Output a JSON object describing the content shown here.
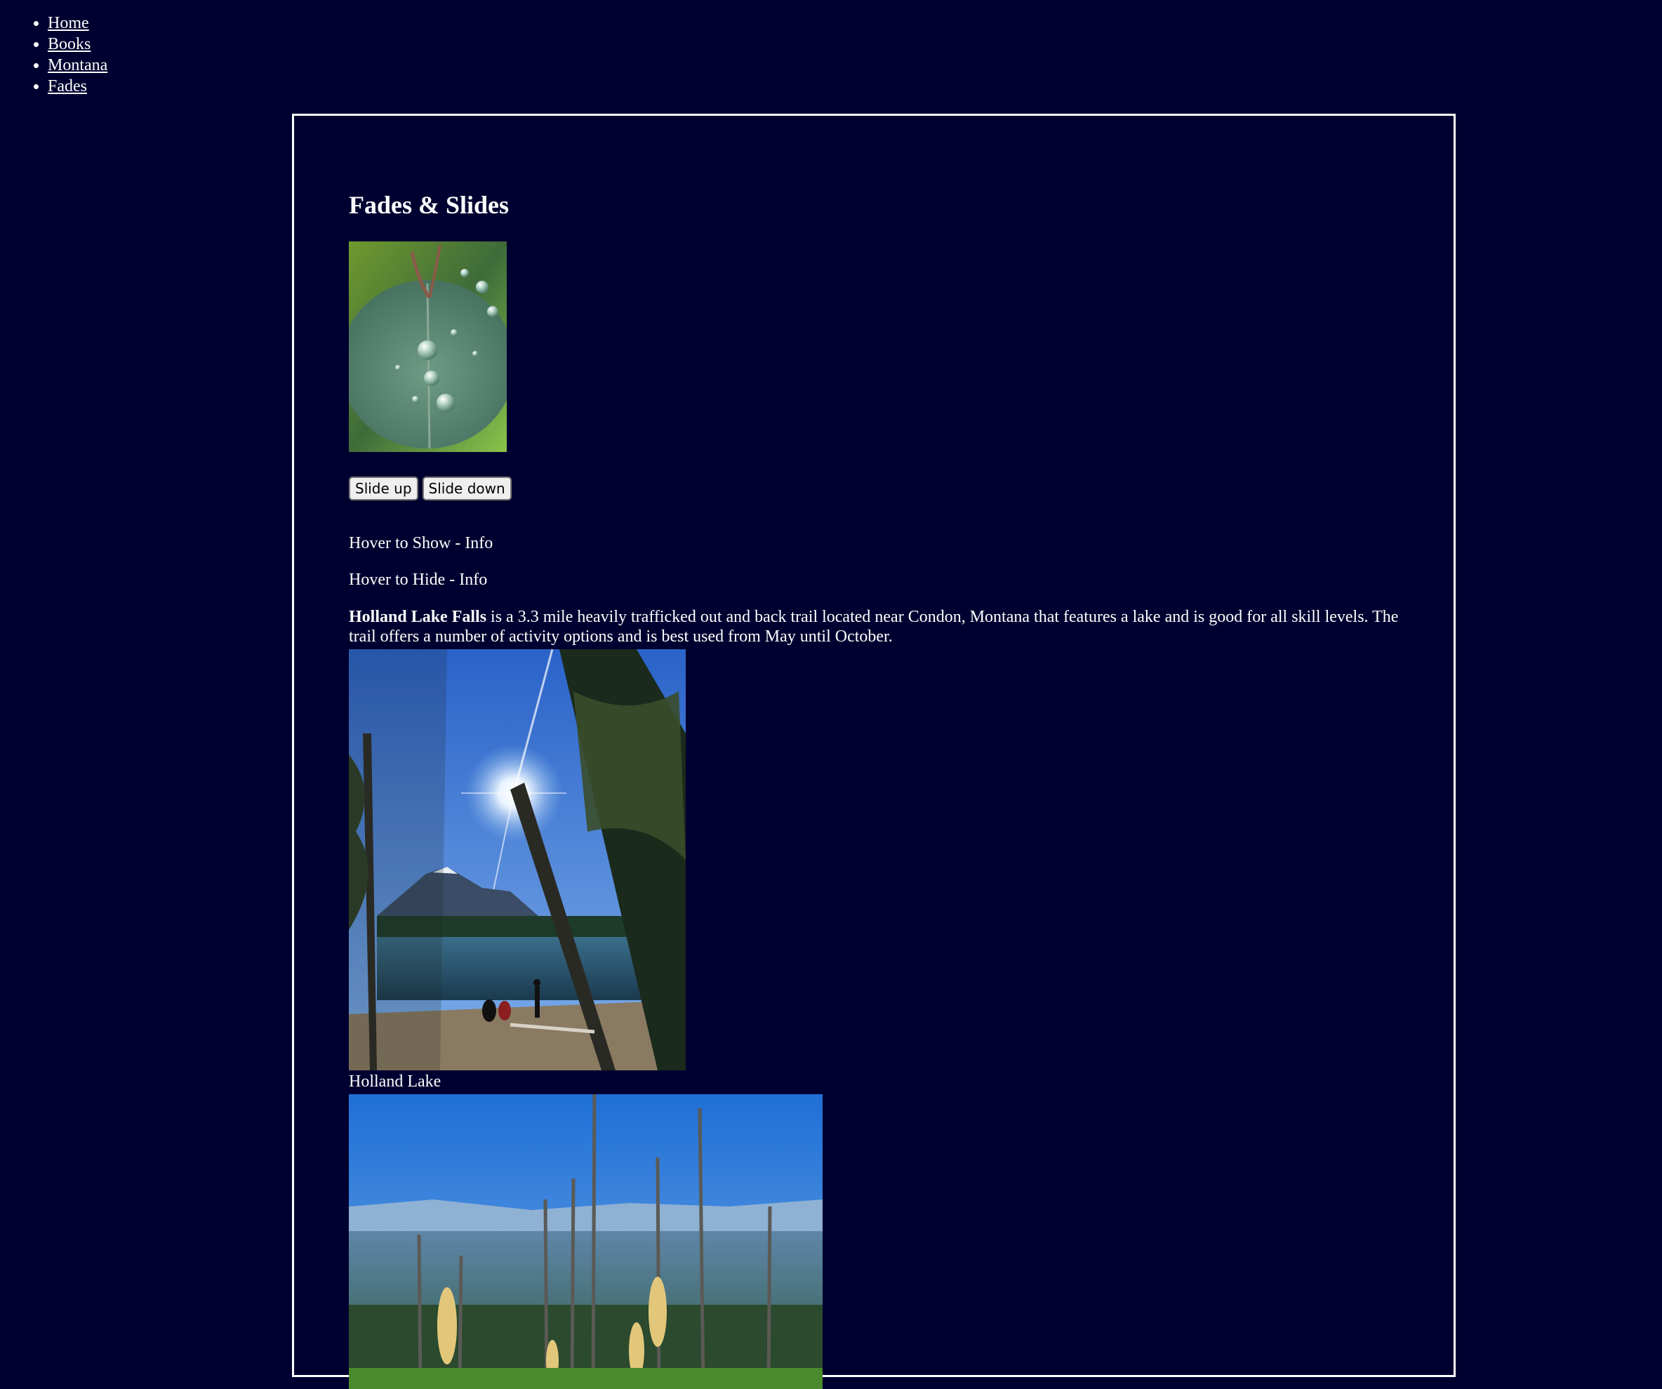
{
  "nav": {
    "items": [
      {
        "label": "Home"
      },
      {
        "label": "Books"
      },
      {
        "label": "Montana"
      },
      {
        "label": "Fades"
      }
    ]
  },
  "main": {
    "title": "Fades & Slides",
    "buttons": {
      "slide_up": "Slide up",
      "slide_down": "Slide down"
    },
    "hover_show": "Hover to Show - Info",
    "hover_hide": "Hover to Hide - Info",
    "description": {
      "bold": "Holland Lake Falls",
      "text": " is a 3.3 mile heavily trafficked out and back trail located near Condon, Montana that features a lake and is good for all skill levels. The trail offers a number of activity options and is best used from May until October."
    },
    "caption": "Holland Lake"
  },
  "colors": {
    "background": "#000030",
    "text": "#ffffff",
    "border": "#ffffff"
  }
}
